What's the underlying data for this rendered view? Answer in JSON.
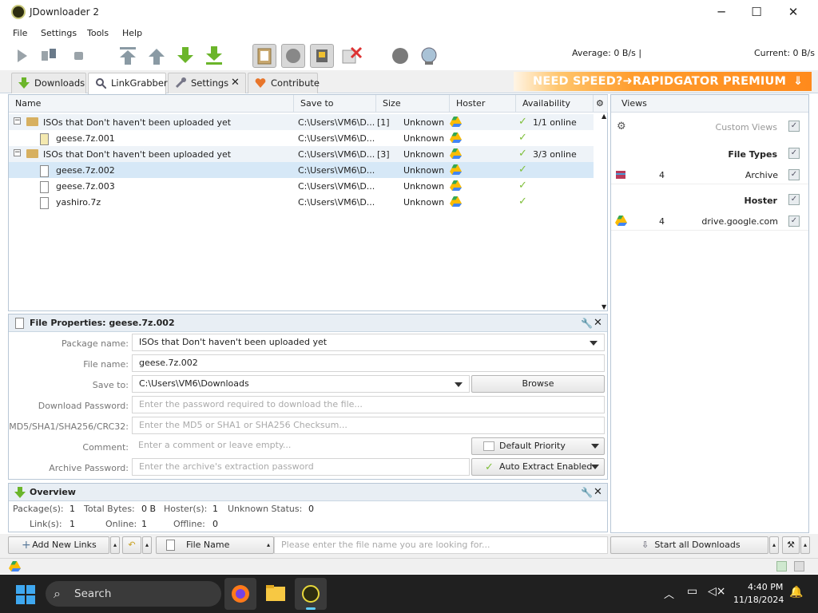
{
  "window": {
    "title": "JDownloader 2",
    "minimize": "─",
    "maximize": "☐",
    "close": "✕"
  },
  "menu": [
    "File",
    "Settings",
    "Tools",
    "Help"
  ],
  "toolbar": {
    "average_speed": "Average: 0 B/s |",
    "current_speed": "Current: 0 B/s"
  },
  "tabs": [
    {
      "label": "Downloads"
    },
    {
      "label": "LinkGrabber"
    },
    {
      "label": "Settings"
    },
    {
      "label": "Contribute"
    }
  ],
  "ad": {
    "text": "NEED SPEED?➜RAPIDGATOR PREMIUM"
  },
  "table": {
    "columns": [
      "Name",
      "Save to",
      "Size",
      "Hoster",
      "Availability"
    ],
    "rows": [
      {
        "type": "package",
        "name": "ISOs that Don't haven't been uploaded yet",
        "save_to": "C:\\Users\\VM6\\D...",
        "count": "[1]",
        "size": "Unknown",
        "availability": "1/1 online"
      },
      {
        "type": "file",
        "name": "geese.7z.001",
        "save_to": "C:\\Users\\VM6\\D...",
        "count": "",
        "size": "Unknown",
        "availability": ""
      },
      {
        "type": "package",
        "name": "ISOs that Don't haven't been uploaded yet",
        "save_to": "C:\\Users\\VM6\\D...",
        "count": "[3]",
        "size": "Unknown",
        "availability": "3/3 online"
      },
      {
        "type": "file",
        "name": "geese.7z.002",
        "save_to": "C:\\Users\\VM6\\D...",
        "count": "",
        "size": "Unknown",
        "availability": ""
      },
      {
        "type": "file",
        "name": "geese.7z.003",
        "save_to": "C:\\Users\\VM6\\D...",
        "count": "",
        "size": "Unknown",
        "availability": ""
      },
      {
        "type": "file",
        "name": "yashiro.7z",
        "save_to": "C:\\Users\\VM6\\D...",
        "count": "",
        "size": "Unknown",
        "availability": ""
      }
    ]
  },
  "views": {
    "header": "Views",
    "custom_views": "Custom Views",
    "file_types": "File Types",
    "archive_count": "4",
    "archive_label": "Archive",
    "hoster": "Hoster",
    "hoster_count": "4",
    "hoster_label": "drive.google.com"
  },
  "properties": {
    "header": "File Properties: geese.7z.002",
    "package_name_label": "Package name:",
    "package_name": "ISOs that Don't haven't been uploaded yet",
    "file_name_label": "File name:",
    "file_name": "geese.7z.002",
    "save_to_label": "Save to:",
    "save_to": "C:\\Users\\VM6\\Downloads",
    "browse": "Browse",
    "download_password_label": "Download Password:",
    "download_password_placeholder": "Enter the password required to download the file...",
    "checksum_label": "MD5/SHA1/SHA256/CRC32:",
    "checksum_placeholder": "Enter the MD5 or SHA1 or SHA256 Checksum...",
    "comment_label": "Comment:",
    "comment_placeholder": "Enter a comment or leave empty...",
    "priority": "Default Priority",
    "archive_password_label": "Archive Password:",
    "archive_password_placeholder": "Enter the archive's extraction password",
    "auto_extract": "Auto Extract Enabled"
  },
  "overview": {
    "header": "Overview",
    "packages_label": "Package(s):",
    "packages": "1",
    "total_bytes_label": "Total Bytes:",
    "total_bytes": "0 B",
    "hosters_label": "Hoster(s):",
    "hosters": "1",
    "unknown_status_label": "Unknown Status:",
    "unknown_status": "0",
    "links_label": "Link(s):",
    "links": "1",
    "online_label": "Online:",
    "online": "1",
    "offline_label": "Offline:",
    "offline": "0"
  },
  "bottom": {
    "add_new_links": "Add New Links",
    "file_name_filter": "File Name",
    "search_placeholder": "Please enter the file name you are looking for...",
    "start_all": "Start all Downloads"
  },
  "taskbar": {
    "search": "Search",
    "time": "4:40 PM",
    "date": "11/18/2024"
  }
}
